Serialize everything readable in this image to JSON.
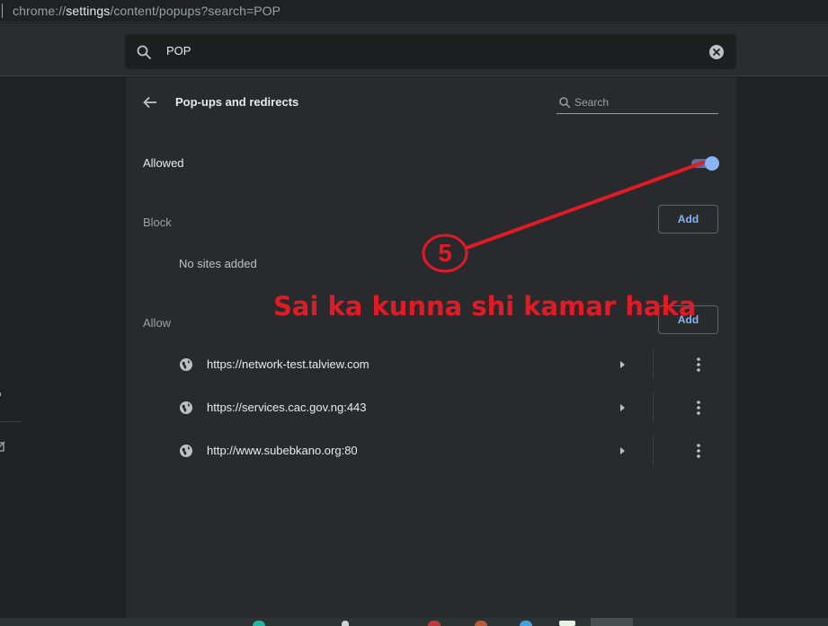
{
  "browser": {
    "address_prefix": "chrome://",
    "address_host": "settings",
    "address_path": "/content/popups?search=POP"
  },
  "settings_search": {
    "value": "POP",
    "search_icon": "search-icon",
    "clear_icon": "clear-search-icon"
  },
  "page": {
    "title": "Pop-ups and redirects",
    "back_icon": "back-arrow-icon",
    "search_placeholder": "Search"
  },
  "allowed": {
    "label": "Allowed",
    "toggle_on": true,
    "toggle_color": "#8ab4f8"
  },
  "block": {
    "label": "Block",
    "add_label": "Add",
    "empty_text": "No sites added"
  },
  "allow": {
    "label": "Allow",
    "add_label": "Add",
    "sites": [
      {
        "url": "https://network-test.talview.com"
      },
      {
        "url": "https://services.cac.gov.ng:443"
      },
      {
        "url": "http://www.subebkano.org:80"
      }
    ]
  },
  "annotation": {
    "step_number": "5",
    "caption": "Sai ka kunna shi kamar haka",
    "color": "#e01b24"
  }
}
